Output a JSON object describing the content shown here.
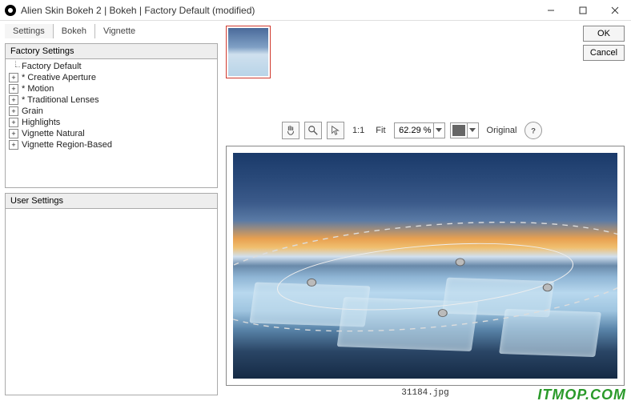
{
  "window": {
    "title": "Alien Skin Bokeh 2 | Bokeh | Factory Default (modified)"
  },
  "buttons": {
    "ok": "OK",
    "cancel": "Cancel"
  },
  "tabs": {
    "settings": "Settings",
    "bokeh": "Bokeh",
    "vignette": "Vignette"
  },
  "panels": {
    "factory_header": "Factory Settings",
    "user_header": "User Settings"
  },
  "tree": {
    "items": [
      {
        "label": "Factory Default",
        "leaf": true
      },
      {
        "label": "* Creative Aperture",
        "leaf": false
      },
      {
        "label": "* Motion",
        "leaf": false
      },
      {
        "label": "* Traditional Lenses",
        "leaf": false
      },
      {
        "label": "Grain",
        "leaf": false
      },
      {
        "label": "Highlights",
        "leaf": false
      },
      {
        "label": "Vignette Natural",
        "leaf": false
      },
      {
        "label": "Vignette Region-Based",
        "leaf": false
      }
    ]
  },
  "toolbar": {
    "oneToOne": "1:1",
    "fit": "Fit",
    "zoom_value": "62.29 %",
    "original": "Original"
  },
  "preview": {
    "filename": "31184.jpg"
  },
  "watermark": "ITMOP.COM"
}
